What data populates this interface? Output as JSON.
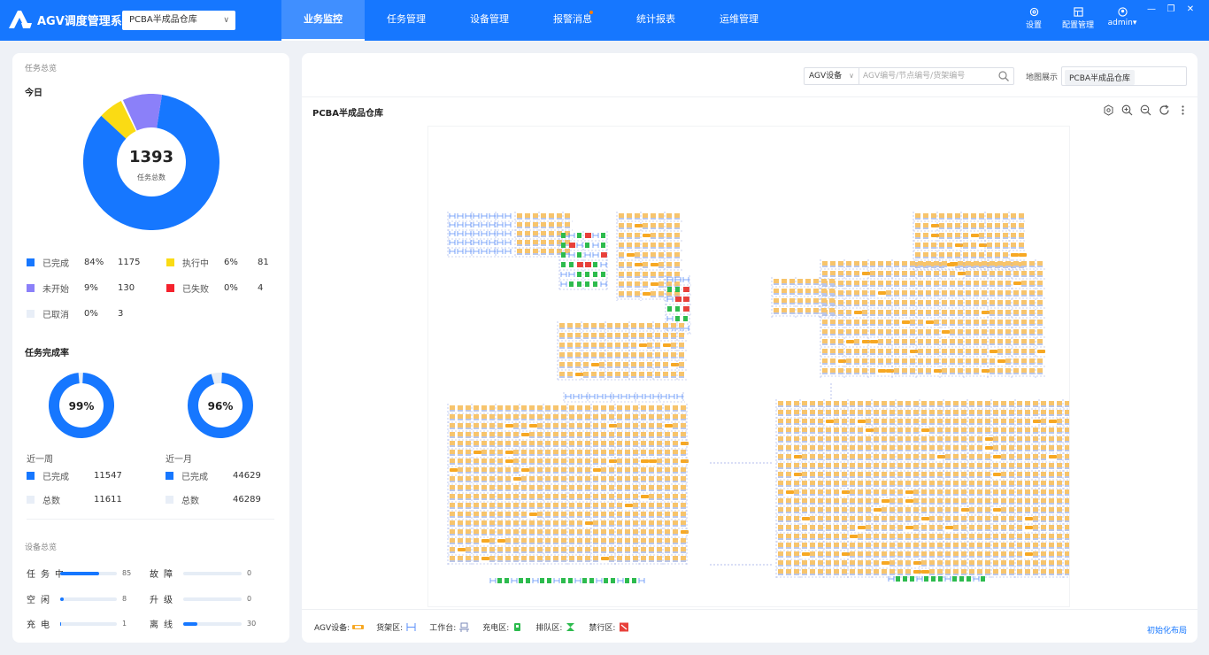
{
  "app": {
    "title": "AGV调度管理系统"
  },
  "warehouse_select": {
    "value": "PCBA半成品仓库"
  },
  "nav": [
    {
      "label": "业务监控",
      "active": true,
      "dot": false
    },
    {
      "label": "任务管理",
      "active": false,
      "dot": false
    },
    {
      "label": "设备管理",
      "active": false,
      "dot": false
    },
    {
      "label": "报警消息",
      "active": false,
      "dot": true
    },
    {
      "label": "统计报表",
      "active": false,
      "dot": false
    },
    {
      "label": "运维管理",
      "active": false,
      "dot": false
    }
  ],
  "header_tools": [
    {
      "label": "设置",
      "icon": "gear-icon"
    },
    {
      "label": "配置管理",
      "icon": "config-icon"
    },
    {
      "label": "admin",
      "icon": "user-icon"
    }
  ],
  "window_controls": [
    "—",
    "❐",
    "✕"
  ],
  "task_overview": {
    "section_label": "任务总览",
    "today_label": "今日",
    "total_value": "1393",
    "total_label": "任务总数",
    "legend": [
      {
        "name": "已完成",
        "pct": "84%",
        "count": "1175",
        "color": "#1677ff"
      },
      {
        "name": "执行中",
        "pct": "6%",
        "count": "81",
        "color": "#fadb14"
      },
      {
        "name": "未开始",
        "pct": "9%",
        "count": "130",
        "color": "#8b80f9"
      },
      {
        "name": "已失败",
        "pct": "0%",
        "count": "4",
        "color": "#f5222d"
      },
      {
        "name": "已取消",
        "pct": "0%",
        "count": "3",
        "color": "#e8eef7"
      }
    ]
  },
  "completion": {
    "title": "任务完成率",
    "week": {
      "pct": "99%",
      "value": 0.99,
      "label": "近一周",
      "done_label": "已完成",
      "done": "11547",
      "total_label": "总数",
      "total": "11611"
    },
    "month": {
      "pct": "96%",
      "value": 0.96,
      "label": "近一月",
      "done_label": "已完成",
      "done": "44629",
      "total_label": "总数",
      "total": "46289"
    }
  },
  "devices": {
    "section_label": "设备总览",
    "items": [
      {
        "name": "任务中",
        "value": "85",
        "fill": 0.69
      },
      {
        "name": "故障",
        "value": "0",
        "fill": 0
      },
      {
        "name": "空闲",
        "value": "8",
        "fill": 0.06
      },
      {
        "name": "升级",
        "value": "0",
        "fill": 0
      },
      {
        "name": "充电",
        "value": "1",
        "fill": 0.02
      },
      {
        "name": "离线",
        "value": "30",
        "fill": 0.24
      }
    ]
  },
  "map_panel": {
    "search_type": "AGV设备",
    "search_placeholder": "AGV编号/节点编号/货架编号",
    "display_label": "地图展示",
    "display_tag": "PCBA半成品仓库",
    "title": "PCBA半成品仓库",
    "legend": [
      {
        "label": "AGV设备:",
        "icon": "agv-icon"
      },
      {
        "label": "货架区:",
        "icon": "shelf-icon"
      },
      {
        "label": "工作台:",
        "icon": "workstation-icon"
      },
      {
        "label": "充电区:",
        "icon": "charging-icon"
      },
      {
        "label": "排队区:",
        "icon": "queue-icon"
      },
      {
        "label": "禁行区:",
        "icon": "forbidden-icon"
      }
    ],
    "reset_label": "初始化布局"
  },
  "colors": {
    "primary": "#1677ff",
    "agv": "#f7a823",
    "shelf": "#5b8ff9",
    "charging": "#2dbb4e",
    "forbidden": "#e8403a"
  }
}
